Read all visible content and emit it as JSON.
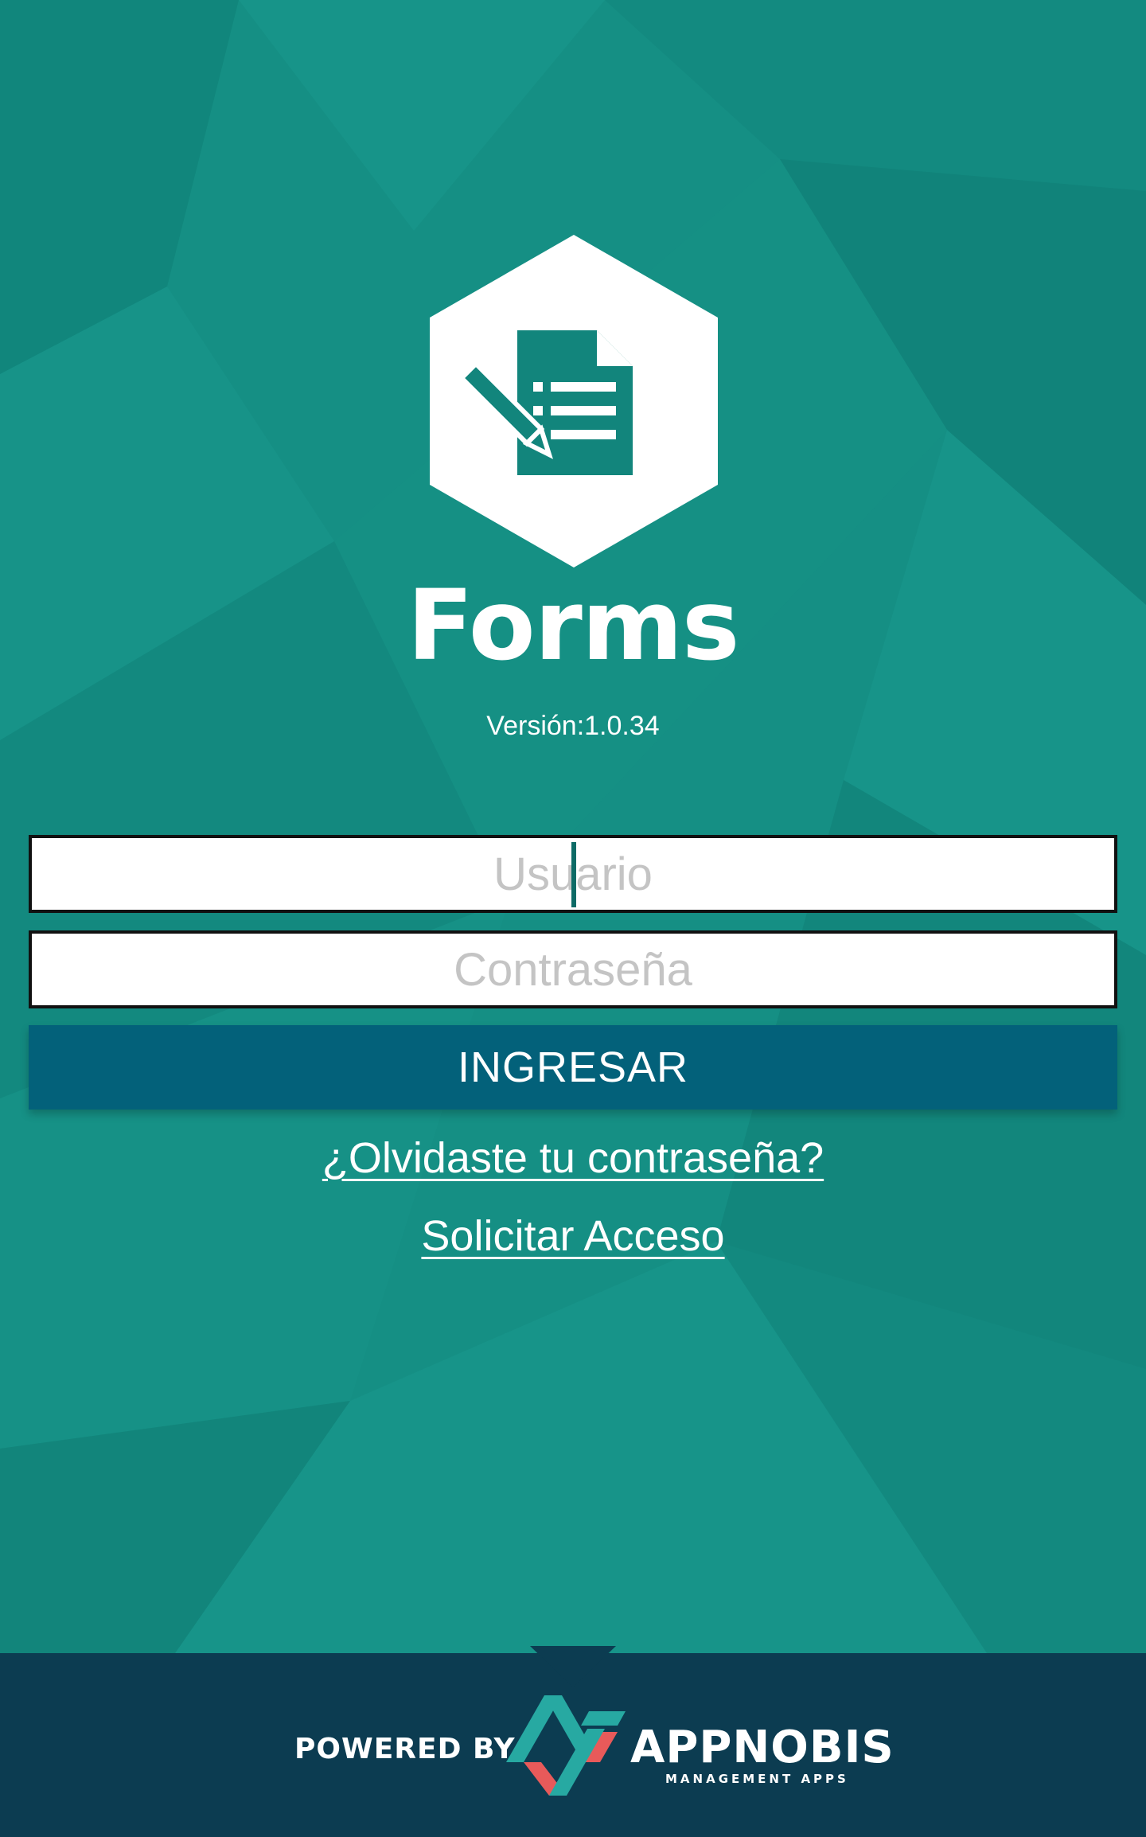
{
  "app": {
    "title": "Forms",
    "version": "Versión:1.0.34",
    "logo_icon": "form-edit-icon"
  },
  "login": {
    "username_placeholder": "Usuario",
    "password_placeholder": "Contraseña",
    "username_value": "",
    "password_value": "",
    "submit_label": "INGRESAR",
    "forgot_link": "¿Olvidaste tu contraseña?",
    "request_access_link": "Solicitar Acceso"
  },
  "footer": {
    "powered_by": "POWERED BY",
    "brand_name": "APPNOBIS",
    "brand_tagline": "MANAGEMENT APPS",
    "brand_icon": "appnobis-logo-icon"
  },
  "colors": {
    "background": "#158f84",
    "button": "#03617a",
    "footer": "#0c3c51",
    "logo_accent": "#12857c",
    "brand_teal": "#27a9a2",
    "brand_red": "#e85a5a"
  }
}
